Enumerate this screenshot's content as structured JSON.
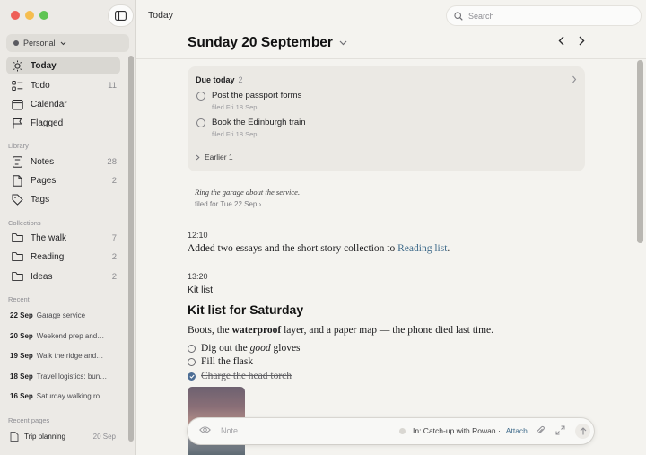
{
  "window": {
    "title": "Today"
  },
  "sidebar": {
    "workspace": "Personal",
    "nav": [
      {
        "label": "Today",
        "icon": "sun-icon",
        "count": ""
      },
      {
        "label": "Todo",
        "icon": "checklist-icon",
        "count": "11"
      },
      {
        "label": "Calendar",
        "icon": "calendar-icon",
        "count": ""
      },
      {
        "label": "Flagged",
        "icon": "flag-icon",
        "count": ""
      }
    ],
    "library_label": "Library",
    "library": [
      {
        "label": "Notes",
        "icon": "note-icon",
        "count": "28"
      },
      {
        "label": "Pages",
        "icon": "pages-icon",
        "count": "2"
      },
      {
        "label": "Tags",
        "icon": "tag-icon",
        "count": ""
      }
    ],
    "collections_label": "Collections",
    "collections": [
      {
        "label": "The walk",
        "icon": "folder-icon",
        "count": "7"
      },
      {
        "label": "Reading",
        "icon": "folder-icon",
        "count": "2"
      },
      {
        "label": "Ideas",
        "icon": "folder-icon",
        "count": "2"
      }
    ],
    "recent_label": "Recent",
    "recent": [
      {
        "date": "22 Sep",
        "text": "Garage service"
      },
      {
        "date": "20 Sep",
        "text": "Weekend prep and…"
      },
      {
        "date": "19 Sep",
        "text": "Walk the ridge and…"
      },
      {
        "date": "18 Sep",
        "text": "Travel logistics: bun…"
      },
      {
        "date": "16 Sep",
        "text": "Saturday walking ro…"
      }
    ],
    "recent_pages_label": "Recent pages",
    "recent_pages": [
      {
        "label": "Trip planning",
        "date": "20 Sep"
      }
    ]
  },
  "search": {
    "placeholder": "Search"
  },
  "main": {
    "date": "Sunday 20 September",
    "due": {
      "title": "Due today",
      "count": "2",
      "tasks": [
        {
          "title": "Post the passport forms",
          "sub": "filed Fri 18 Sep"
        },
        {
          "title": "Book the Edinburgh train",
          "sub": "filed Fri 18 Sep"
        }
      ],
      "earlier": "Earlier 1"
    },
    "quote": {
      "text": "Ring the garage about the service.",
      "filed": "filed for Tue 22 Sep ›"
    },
    "entry1": {
      "time": "12:10",
      "text": "Added two essays and the short story collection to ",
      "link": "Reading list",
      "end": "."
    },
    "entry2": {
      "time": "13:20",
      "heading": "Kit list",
      "subheading": "Kit list for Saturday",
      "p_pre": "Boots, the ",
      "p_bold": "waterproof",
      "p_post": " layer, and a paper map — the phone died last time.",
      "checks": [
        {
          "pre": "Dig out the ",
          "em": "good",
          "post": " gloves",
          "done": false
        },
        {
          "pre": "Fill the flask",
          "em": "",
          "post": "",
          "done": false
        },
        {
          "pre": "Charge the head torch",
          "em": "",
          "post": "",
          "done": true
        }
      ]
    }
  },
  "composer": {
    "placeholder": "Note…",
    "context": "In: Catch-up with Rowan ·",
    "attach": "Attach"
  },
  "colors": {
    "accent": "#3e6a8a",
    "check_done": "#4c6d94"
  }
}
